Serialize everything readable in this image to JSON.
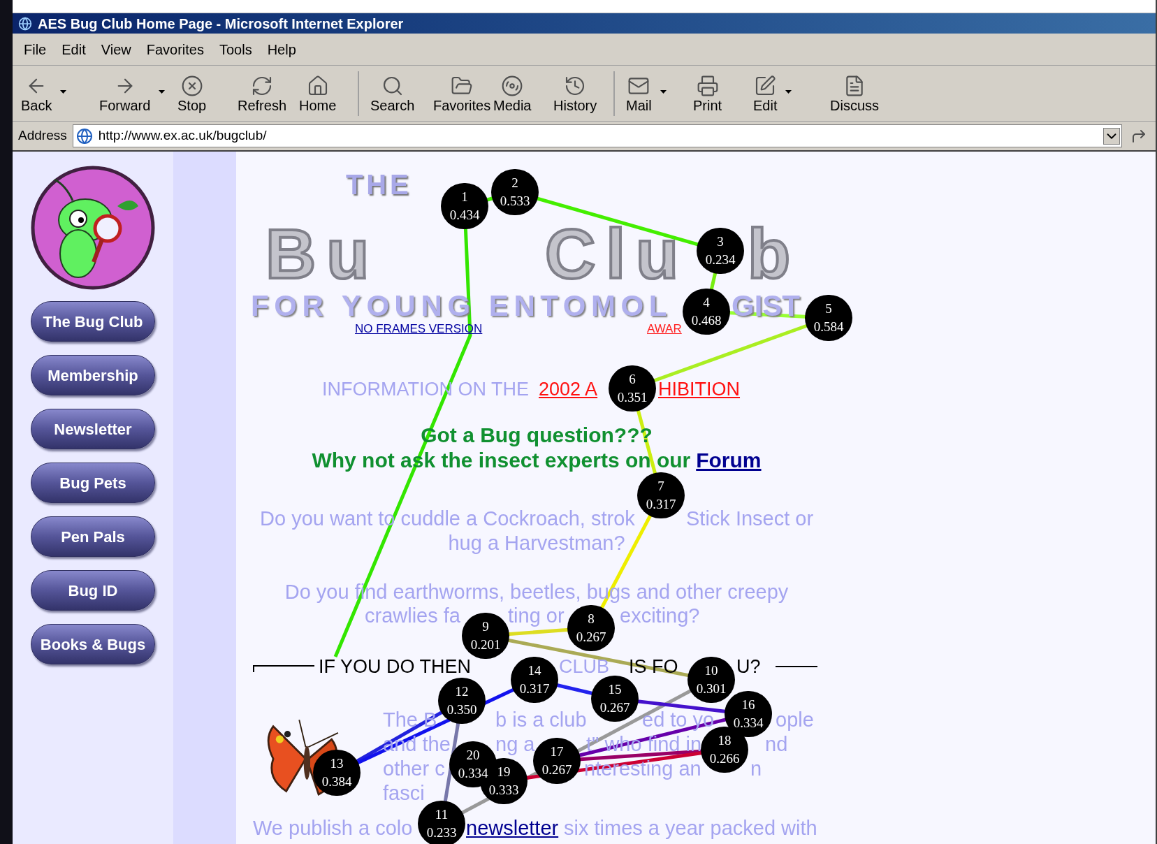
{
  "window": {
    "title": "AES Bug Club Home Page - Microsoft Internet Explorer"
  },
  "menu": [
    "File",
    "Edit",
    "View",
    "Favorites",
    "Tools",
    "Help"
  ],
  "toolbar_groups": [
    {
      "buttons": [
        {
          "label": "Back",
          "dropdown": true
        },
        {
          "label": "Forward",
          "dropdown": true
        },
        {
          "label": "Stop",
          "dropdown": false
        },
        {
          "label": "Refresh",
          "dropdown": false
        },
        {
          "label": "Home",
          "dropdown": false
        }
      ]
    },
    {
      "buttons": [
        {
          "label": "Search",
          "dropdown": false
        },
        {
          "label": "Favorites",
          "dropdown": false
        },
        {
          "label": "Media",
          "dropdown": false
        },
        {
          "label": "History",
          "dropdown": false
        }
      ]
    },
    {
      "buttons": [
        {
          "label": "Mail",
          "dropdown": true
        },
        {
          "label": "Print",
          "dropdown": false
        },
        {
          "label": "Edit",
          "dropdown": true
        },
        {
          "label": "Discuss",
          "dropdown": false
        }
      ]
    }
  ],
  "address": {
    "label": "Address",
    "value": "http://www.ex.ac.uk/bugclub/"
  },
  "sidebar": {
    "items": [
      "The Bug Club",
      "Membership",
      "Newsletter",
      "Bug Pets",
      "Pen Pals",
      "Bug ID",
      "Books & Bugs"
    ]
  },
  "page": {
    "logo_top": "THE",
    "logo_main": [
      "Bu",
      "Clu",
      "b"
    ],
    "logo_sub": [
      "FOR YOUNG ENTOMOL",
      "GIST"
    ],
    "links": [
      "NO FRAMES VERSION",
      "AWAR"
    ],
    "info": {
      "text": "INFORMATION ON THE",
      "link_parts": [
        "2002 A",
        "HIBITION"
      ]
    },
    "question": "Got a Bug question???",
    "forum": {
      "text": "Why not ask the insect experts on our",
      "link": "Forum"
    },
    "paragraphs": [
      {
        "lines": [
          [
            "Do you want to cuddle a Cockroach, strok",
            "Stick Insect or"
          ],
          [
            "hug a Harvestman?"
          ]
        ]
      },
      {
        "lines": [
          [
            "Do you find earthworms, beetles, bugs and other creepy"
          ],
          [
            "crawlies fa",
            "ting or",
            "exciting?"
          ]
        ]
      }
    ],
    "divider": [
      {
        "text": "IF YOU DO THEN",
        "highlight": false
      },
      {
        "text": "CLUB",
        "highlight": true
      },
      {
        "text": "IS FO",
        "highlight": false
      },
      {
        "text": "U?",
        "highlight": false
      }
    ],
    "intro": [
      [
        "The B",
        "b is a club",
        "ed to yo",
        "ople"
      ],
      [
        "and the",
        "ng a",
        "t\" who find in",
        "nd"
      ],
      [
        "other c",
        "nteresting an",
        "n"
      ],
      [
        "fasci"
      ]
    ],
    "newsletter": {
      "before": "We publish a colo",
      "link": "newsletter",
      "after": "six times a year packed with"
    }
  },
  "fixations": [
    {
      "number": "1",
      "value": "0.434",
      "color": "#44ee00"
    },
    {
      "number": "2",
      "value": "0.533",
      "color": "#44ee00"
    },
    {
      "number": "3",
      "value": "0.234",
      "color": "#77ee11"
    },
    {
      "number": "4",
      "value": "0.468",
      "color": "#99ff33"
    },
    {
      "number": "5",
      "value": "0.584",
      "color": "#aaee22"
    },
    {
      "number": "6",
      "value": "0.351",
      "color": "#ccee11"
    },
    {
      "number": "7",
      "value": "0.317",
      "color": "#eeee00"
    },
    {
      "number": "8",
      "value": "0.267",
      "color": "#dddd22"
    },
    {
      "number": "9",
      "value": "0.201",
      "color": "#aaaa55"
    },
    {
      "number": "10",
      "value": "0.301",
      "color": "#999999"
    },
    {
      "number": "11",
      "value": "0.233",
      "color": "#7777aa"
    },
    {
      "number": "12",
      "value": "0.350",
      "color": "#2222dd"
    },
    {
      "number": "13",
      "value": "0.384",
      "color": "#1111ee"
    },
    {
      "number": "14",
      "value": "0.317",
      "color": "#2222ee"
    },
    {
      "number": "15",
      "value": "0.267",
      "color": "#4411cc"
    },
    {
      "number": "16",
      "value": "0.334",
      "color": "#6600aa"
    },
    {
      "number": "17",
      "value": "0.267",
      "color": "#990066"
    },
    {
      "number": "18",
      "value": "0.266",
      "color": "#cc0033"
    },
    {
      "number": "19",
      "value": "0.333"
    },
    {
      "number": "20",
      "value": "0.334"
    }
  ]
}
